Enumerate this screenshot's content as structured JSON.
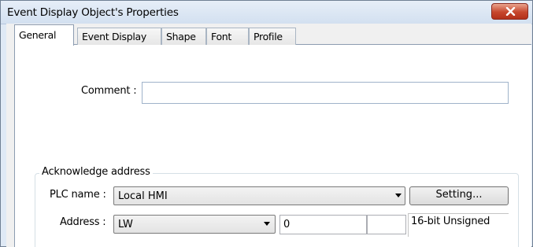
{
  "window": {
    "title": "Event Display Object's Properties"
  },
  "tabs": [
    {
      "label": "General",
      "active": true
    },
    {
      "label": "Event Display",
      "active": false
    },
    {
      "label": "Shape",
      "active": false
    },
    {
      "label": "Font",
      "active": false
    },
    {
      "label": "Profile",
      "active": false
    }
  ],
  "general": {
    "comment_label": "Comment :",
    "comment_value": ""
  },
  "acknowledge": {
    "group_label": "Acknowledge address",
    "plc_name_label": "PLC name :",
    "plc_name_value": "Local HMI",
    "setting_button": "Setting...",
    "address_label": "Address :",
    "address_device": "LW",
    "address_value": "0",
    "address_extra": "",
    "data_type": "16-bit Unsigned"
  },
  "icons": {
    "close": "close-icon",
    "dropdown": "chevron-down-icon"
  },
  "colors": {
    "titlebar": "#dfe9f5",
    "close_button": "#c6462c",
    "panel": "#ffffff"
  }
}
